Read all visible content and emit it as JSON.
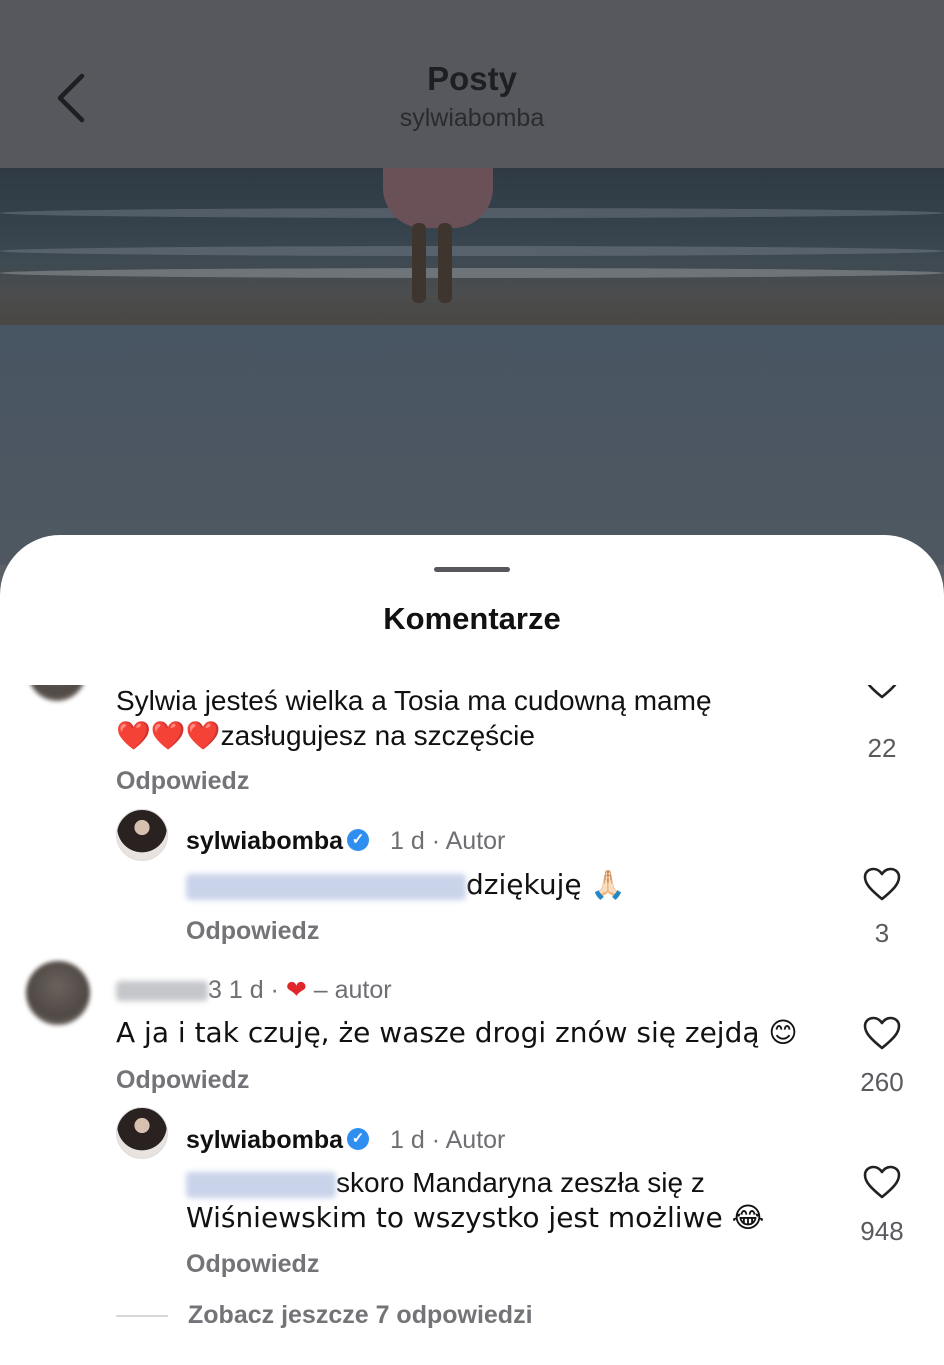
{
  "header": {
    "title": "Posty",
    "subtitle": "sylwiabomba"
  },
  "sheet": {
    "title": "Komentarze"
  },
  "comments": [
    {
      "text_line1": "Sylwia jesteś wielka a Tosia ma cudowną mamę",
      "emoji": "❤️❤️❤️",
      "text_line2": "zasługujesz na szczęście",
      "reply": "Odpowiedz",
      "likes": "22"
    },
    {
      "username": "sylwiabomba",
      "time": "1 d",
      "tag": "· Autor",
      "text": "dziękuję 🙏🏻",
      "reply": "Odpowiedz",
      "likes": "3"
    },
    {
      "username_suffix": "3",
      "time": "1 d ·",
      "heart": "❤",
      "tag": "– autor",
      "text": "A ja i tak czuję, że wasze drogi znów się zejdą 😊",
      "reply": "Odpowiedz",
      "likes": "260"
    },
    {
      "username": "sylwiabomba",
      "time": "1 d",
      "tag": "· Autor",
      "text_line1": "skoro Mandaryna zeszła się z",
      "text_line2": "Wiśniewskim to wszystko jest możliwe 😂",
      "reply": "Odpowiedz",
      "likes": "948"
    }
  ],
  "more_replies": "Zobacz jeszcze 7 odpowiedzi"
}
